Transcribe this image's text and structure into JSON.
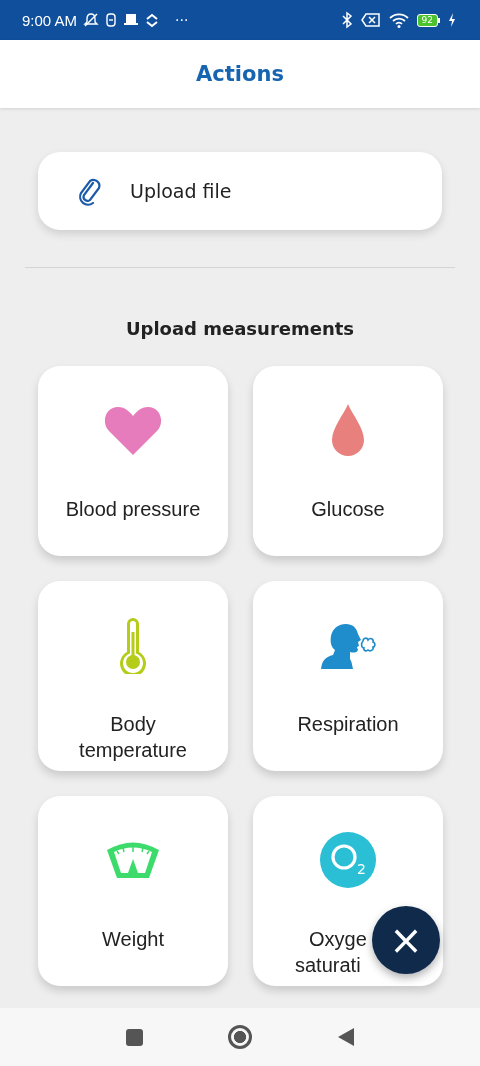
{
  "status_bar": {
    "time": "9:00 AM",
    "more": "···",
    "battery": "92",
    "charging": true
  },
  "header": {
    "title": "Actions"
  },
  "upload_file": {
    "label": "Upload file"
  },
  "section": {
    "title": "Upload measurements"
  },
  "tiles": [
    {
      "kind": "heart",
      "lines": [
        "Blood pressure"
      ]
    },
    {
      "kind": "drop",
      "lines": [
        "Glucose"
      ]
    },
    {
      "kind": "thermometer",
      "lines": [
        "Body",
        "temperature"
      ]
    },
    {
      "kind": "breath",
      "lines": [
        "Respiration"
      ]
    },
    {
      "kind": "scale",
      "lines": [
        "Weight"
      ]
    },
    {
      "kind": "oxygen",
      "icon_text": "2",
      "lines": [
        "Oxyge",
        "saturati"
      ]
    }
  ],
  "fab": {
    "symbol": "×"
  }
}
